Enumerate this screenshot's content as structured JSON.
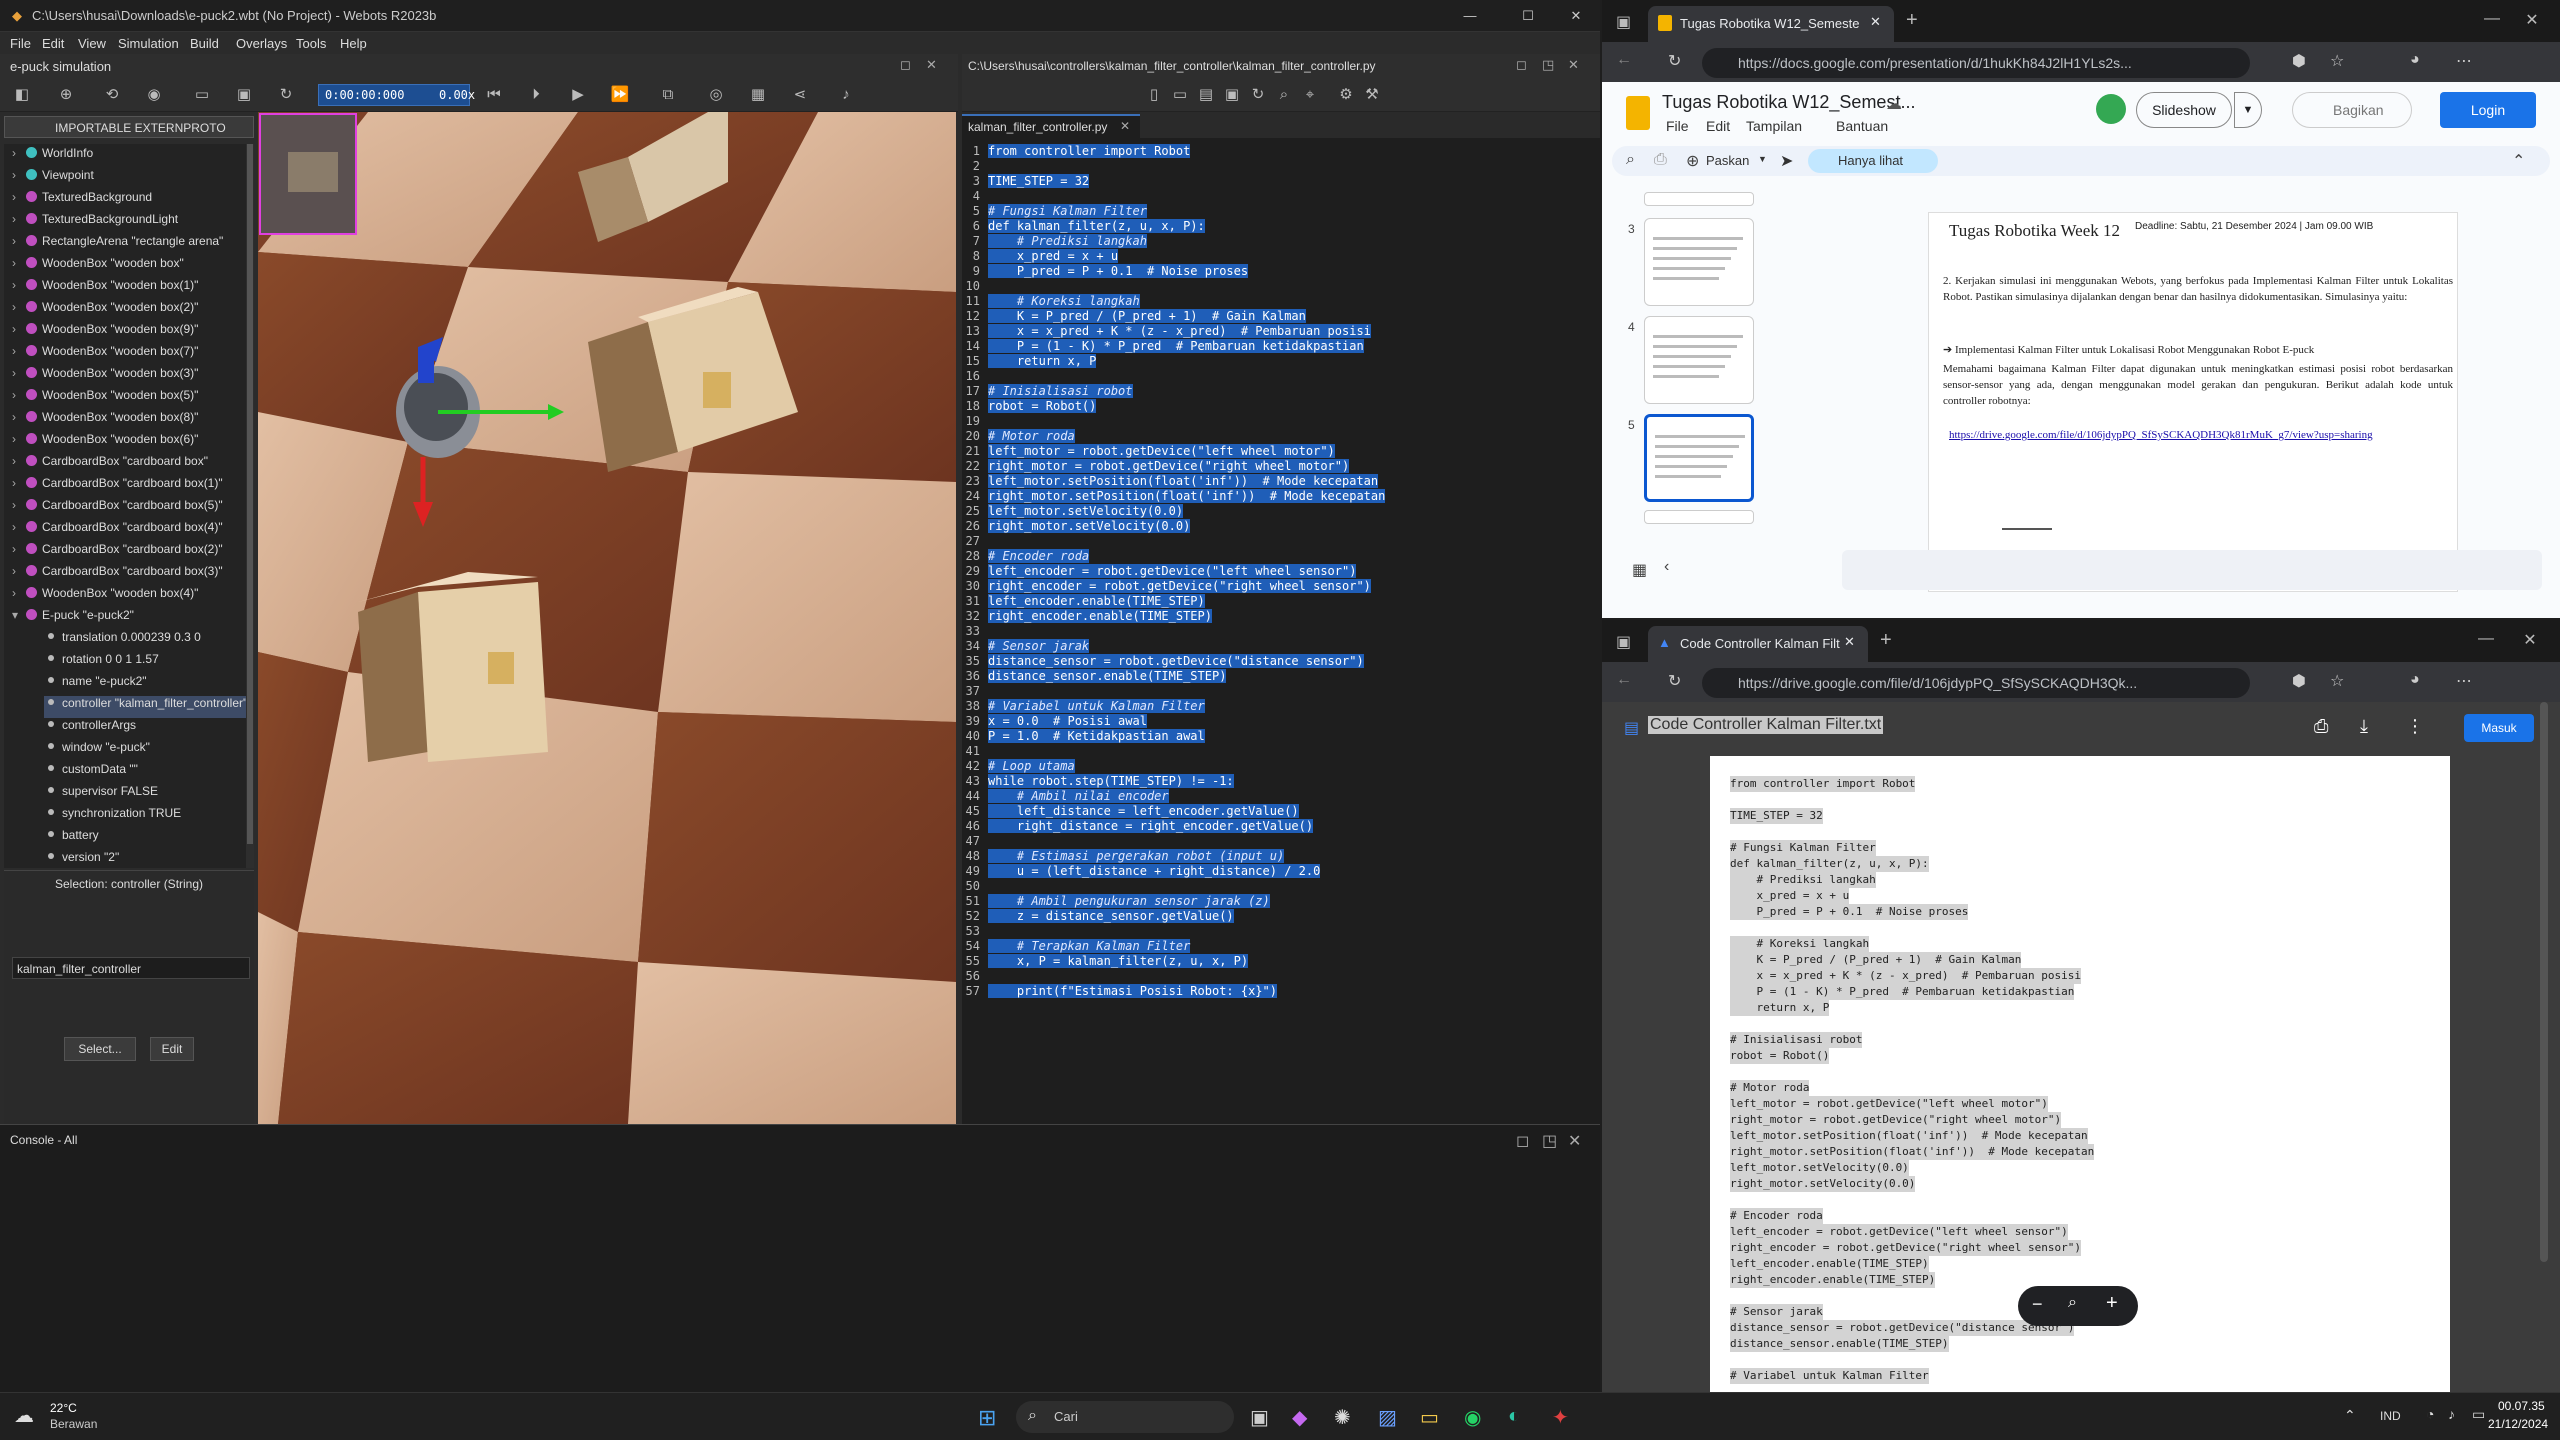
{
  "webots": {
    "window_title": "C:\\Users\\husai\\Downloads\\e-puck2.wbt (No Project) - Webots R2023b",
    "menu": [
      "File",
      "Edit",
      "View",
      "Simulation",
      "Build",
      "Overlays",
      "Tools",
      "Help"
    ],
    "sim_panel_title": "e-puck simulation",
    "time": "0:00:00:000",
    "speed": "0.00x",
    "importable": "IMPORTABLE EXTERNPROTO",
    "tree": [
      {
        "label": "WorldInfo",
        "color": "#3fc0c0"
      },
      {
        "label": "Viewpoint",
        "color": "#3fc0c0"
      },
      {
        "label": "TexturedBackground",
        "color": "#c04fc0"
      },
      {
        "label": "TexturedBackgroundLight",
        "color": "#c04fc0"
      },
      {
        "label": "RectangleArena \"rectangle arena\"",
        "color": "#c04fc0"
      },
      {
        "label": "WoodenBox \"wooden box\"",
        "color": "#c04fc0"
      },
      {
        "label": "WoodenBox \"wooden box(1)\"",
        "color": "#c04fc0"
      },
      {
        "label": "WoodenBox \"wooden box(2)\"",
        "color": "#c04fc0"
      },
      {
        "label": "WoodenBox \"wooden box(9)\"",
        "color": "#c04fc0"
      },
      {
        "label": "WoodenBox \"wooden box(7)\"",
        "color": "#c04fc0"
      },
      {
        "label": "WoodenBox \"wooden box(3)\"",
        "color": "#c04fc0"
      },
      {
        "label": "WoodenBox \"wooden box(5)\"",
        "color": "#c04fc0"
      },
      {
        "label": "WoodenBox \"wooden box(8)\"",
        "color": "#c04fc0"
      },
      {
        "label": "WoodenBox \"wooden box(6)\"",
        "color": "#c04fc0"
      },
      {
        "label": "CardboardBox \"cardboard box\"",
        "color": "#c04fc0"
      },
      {
        "label": "CardboardBox \"cardboard box(1)\"",
        "color": "#c04fc0"
      },
      {
        "label": "CardboardBox \"cardboard box(5)\"",
        "color": "#c04fc0"
      },
      {
        "label": "CardboardBox \"cardboard box(4)\"",
        "color": "#c04fc0"
      },
      {
        "label": "CardboardBox \"cardboard box(2)\"",
        "color": "#c04fc0"
      },
      {
        "label": "CardboardBox \"cardboard box(3)\"",
        "color": "#c04fc0"
      },
      {
        "label": "WoodenBox \"wooden box(4)\"",
        "color": "#c04fc0"
      },
      {
        "label": "E-puck \"e-puck2\"",
        "color": "#c04fc0"
      }
    ],
    "fields": [
      "translation 0.000239 0.3 0",
      "rotation 0 0 1 1.57",
      "name \"e-puck2\"",
      "controller \"kalman_filter_controller\"",
      "controllerArgs",
      "window \"e-puck\"",
      "customData \"\"",
      "supervisor FALSE",
      "synchronization TRUE",
      "battery",
      "version \"2\""
    ],
    "selection_label": "Selection: controller (String)",
    "controller_value": "kalman_filter_controller",
    "select_btn": "Select...",
    "edit_btn": "Edit",
    "editor_path": "C:\\Users\\husai\\controllers\\kalman_filter_controller\\kalman_filter_controller.py",
    "editor_tab": "kalman_filter_controller.py",
    "console_title": "Console - All"
  },
  "code": [
    "from controller import Robot",
    "",
    "TIME_STEP = 32",
    "",
    "# Fungsi Kalman Filter",
    "def kalman_filter(z, u, x, P):",
    "    # Prediksi langkah",
    "    x_pred = x + u",
    "    P_pred = P + 0.1  # Noise proses",
    "",
    "    # Koreksi langkah",
    "    K = P_pred / (P_pred + 1)  # Gain Kalman",
    "    x = x_pred + K * (z - x_pred)  # Pembaruan posisi",
    "    P = (1 - K) * P_pred  # Pembaruan ketidakpastian",
    "    return x, P",
    "",
    "# Inisialisasi robot",
    "robot = Robot()",
    "",
    "# Motor roda",
    "left_motor = robot.getDevice(\"left wheel motor\")",
    "right_motor = robot.getDevice(\"right wheel motor\")",
    "left_motor.setPosition(float('inf'))  # Mode kecepatan",
    "right_motor.setPosition(float('inf'))  # Mode kecepatan",
    "left_motor.setVelocity(0.0)",
    "right_motor.setVelocity(0.0)",
    "",
    "# Encoder roda",
    "left_encoder = robot.getDevice(\"left wheel sensor\")",
    "right_encoder = robot.getDevice(\"right wheel sensor\")",
    "left_encoder.enable(TIME_STEP)",
    "right_encoder.enable(TIME_STEP)",
    "",
    "# Sensor jarak",
    "distance_sensor = robot.getDevice(\"distance sensor\")",
    "distance_sensor.enable(TIME_STEP)",
    "",
    "# Variabel untuk Kalman Filter",
    "x = 0.0  # Posisi awal",
    "P = 1.0  # Ketidakpastian awal",
    "",
    "# Loop utama",
    "while robot.step(TIME_STEP) != -1:",
    "    # Ambil nilai encoder",
    "    left_distance = left_encoder.getValue()",
    "    right_distance = right_encoder.getValue()",
    "",
    "    # Estimasi pergerakan robot (input u)",
    "    u = (left_distance + right_distance) / 2.0",
    "",
    "    # Ambil pengukuran sensor jarak (z)",
    "    z = distance_sensor.getValue()",
    "",
    "    # Terapkan Kalman Filter",
    "    x, P = kalman_filter(z, u, x, P)",
    "",
    "    print(f\"Estimasi Posisi Robot: {x}\")"
  ],
  "slides": {
    "tab": "Tugas Robotika W12_Semester G",
    "url": "https://docs.google.com/presentation/d/1hukKh84J2lH1YLs2s...",
    "doc_title": "Tugas Robotika W12_Semest...",
    "menu": [
      "File",
      "Edit",
      "Tampilan",
      "Bantuan"
    ],
    "slideshow": "Slideshow",
    "share": "Bagikan",
    "login": "Login",
    "zoom": "Paskan",
    "view_only": "Hanya lihat",
    "slide_nums": [
      "3",
      "4",
      "5"
    ],
    "slide_title": "Tugas Robotika Week 12",
    "deadline": "Deadline: Sabtu, 21 Desember 2024  | Jam 09.00 WIB",
    "p1": "2.  Kerjakan simulasi ini menggunakan Webots, yang berfokus pada Implementasi Kalman Filter untuk Lokalitas Robot. Pastikan simulasinya dijalankan dengan benar dan hasilnya didokumentasikan. Simulasinya yaitu:",
    "bullet": "Implementasi Kalman Filter untuk Lokalisasi Robot Menggunakan Robot E-puck",
    "p2": "Memahami bagaimana Kalman Filter dapat digunakan untuk meningkatkan estimasi posisi robot berdasarkan sensor-sensor yang ada, dengan menggunakan model gerakan dan pengukuran. Berikut adalah kode untuk controller robotnya:",
    "link": "https://drive.google.com/file/d/106jdypPQ_SfSySCKAQDH3Qk81rMuK_g7/view?usp=sharing"
  },
  "drive": {
    "tab": "Code Controller Kalman Filter.txt",
    "url": "https://drive.google.com/file/d/106jdypPQ_SfSySCKAQDH3Qk...",
    "file_title": "Code Controller Kalman Filter.txt",
    "login": "Masuk",
    "lines": [
      "from controller import Robot",
      "",
      "TIME_STEP = 32",
      "",
      "# Fungsi Kalman Filter",
      "def kalman_filter(z, u, x, P):",
      "    # Prediksi langkah",
      "    x_pred = x + u",
      "    P_pred = P + 0.1  # Noise proses",
      "",
      "    # Koreksi langkah",
      "    K = P_pred / (P_pred + 1)  # Gain Kalman",
      "    x = x_pred + K * (z - x_pred)  # Pembaruan posisi",
      "    P = (1 - K) * P_pred  # Pembaruan ketidakpastian",
      "    return x, P",
      "",
      "# Inisialisasi robot",
      "robot = Robot()",
      "",
      "# Motor roda",
      "left_motor = robot.getDevice(\"left wheel motor\")",
      "right_motor = robot.getDevice(\"right wheel motor\")",
      "left_motor.setPosition(float('inf'))  # Mode kecepatan",
      "right_motor.setPosition(float('inf'))  # Mode kecepatan",
      "left_motor.setVelocity(0.0)",
      "right_motor.setVelocity(0.0)",
      "",
      "# Encoder roda",
      "left_encoder = robot.getDevice(\"left wheel sensor\")",
      "right_encoder = robot.getDevice(\"right wheel sensor\")",
      "left_encoder.enable(TIME_STEP)",
      "right_encoder.enable(TIME_STEP)",
      "",
      "# Sensor jarak",
      "distance_sensor = robot.getDevice(\"distance sensor\")",
      "distance_sensor.enable(TIME_STEP)",
      "",
      "# Variabel untuk Kalman Filter"
    ]
  },
  "taskbar": {
    "temp": "22°C",
    "weather": "Berawan",
    "search": "Cari",
    "lang": "IND",
    "time": "00.07.35",
    "date": "21/12/2024"
  }
}
